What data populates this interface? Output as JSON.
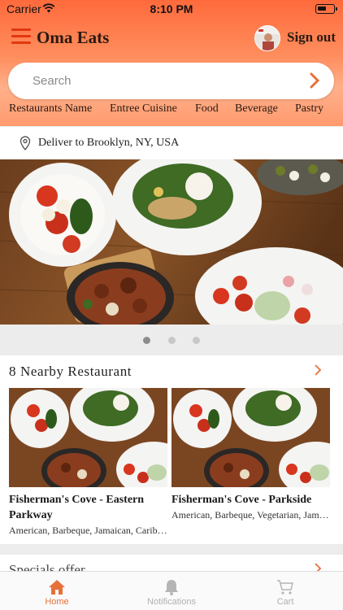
{
  "status_bar": {
    "carrier": "Carrier",
    "time": "8:10 PM"
  },
  "header": {
    "app_title": "Oma Eats",
    "signout_label": "Sign out",
    "accent": "#ff6a3c"
  },
  "search": {
    "placeholder": "Search"
  },
  "categories": [
    "Restaurants Name",
    "Entree Cuisine",
    "Food",
    "Beverage",
    "Pastry"
  ],
  "delivery": {
    "label": "Deliver to Brooklyn, NY, USA"
  },
  "banner": {
    "slides": 3,
    "active_slide": 1
  },
  "nearby": {
    "title": "8 Nearby Restaurant",
    "restaurants": [
      {
        "name": "Fisherman's Cove - Eastern Parkway",
        "tags": "American, Barbeque, Jamaican, Caribbean"
      },
      {
        "name": "Fisherman's Cove - Parkside",
        "tags": "American, Barbeque, Vegetarian, Jamaican"
      }
    ]
  },
  "next_section": {
    "title": "Specials offer"
  },
  "tabbar": {
    "items": [
      {
        "label": "Home",
        "icon": "home-icon",
        "active": true
      },
      {
        "label": "Notifications",
        "icon": "bell-icon",
        "active": false
      },
      {
        "label": "Cart",
        "icon": "cart-icon",
        "active": false
      }
    ]
  }
}
